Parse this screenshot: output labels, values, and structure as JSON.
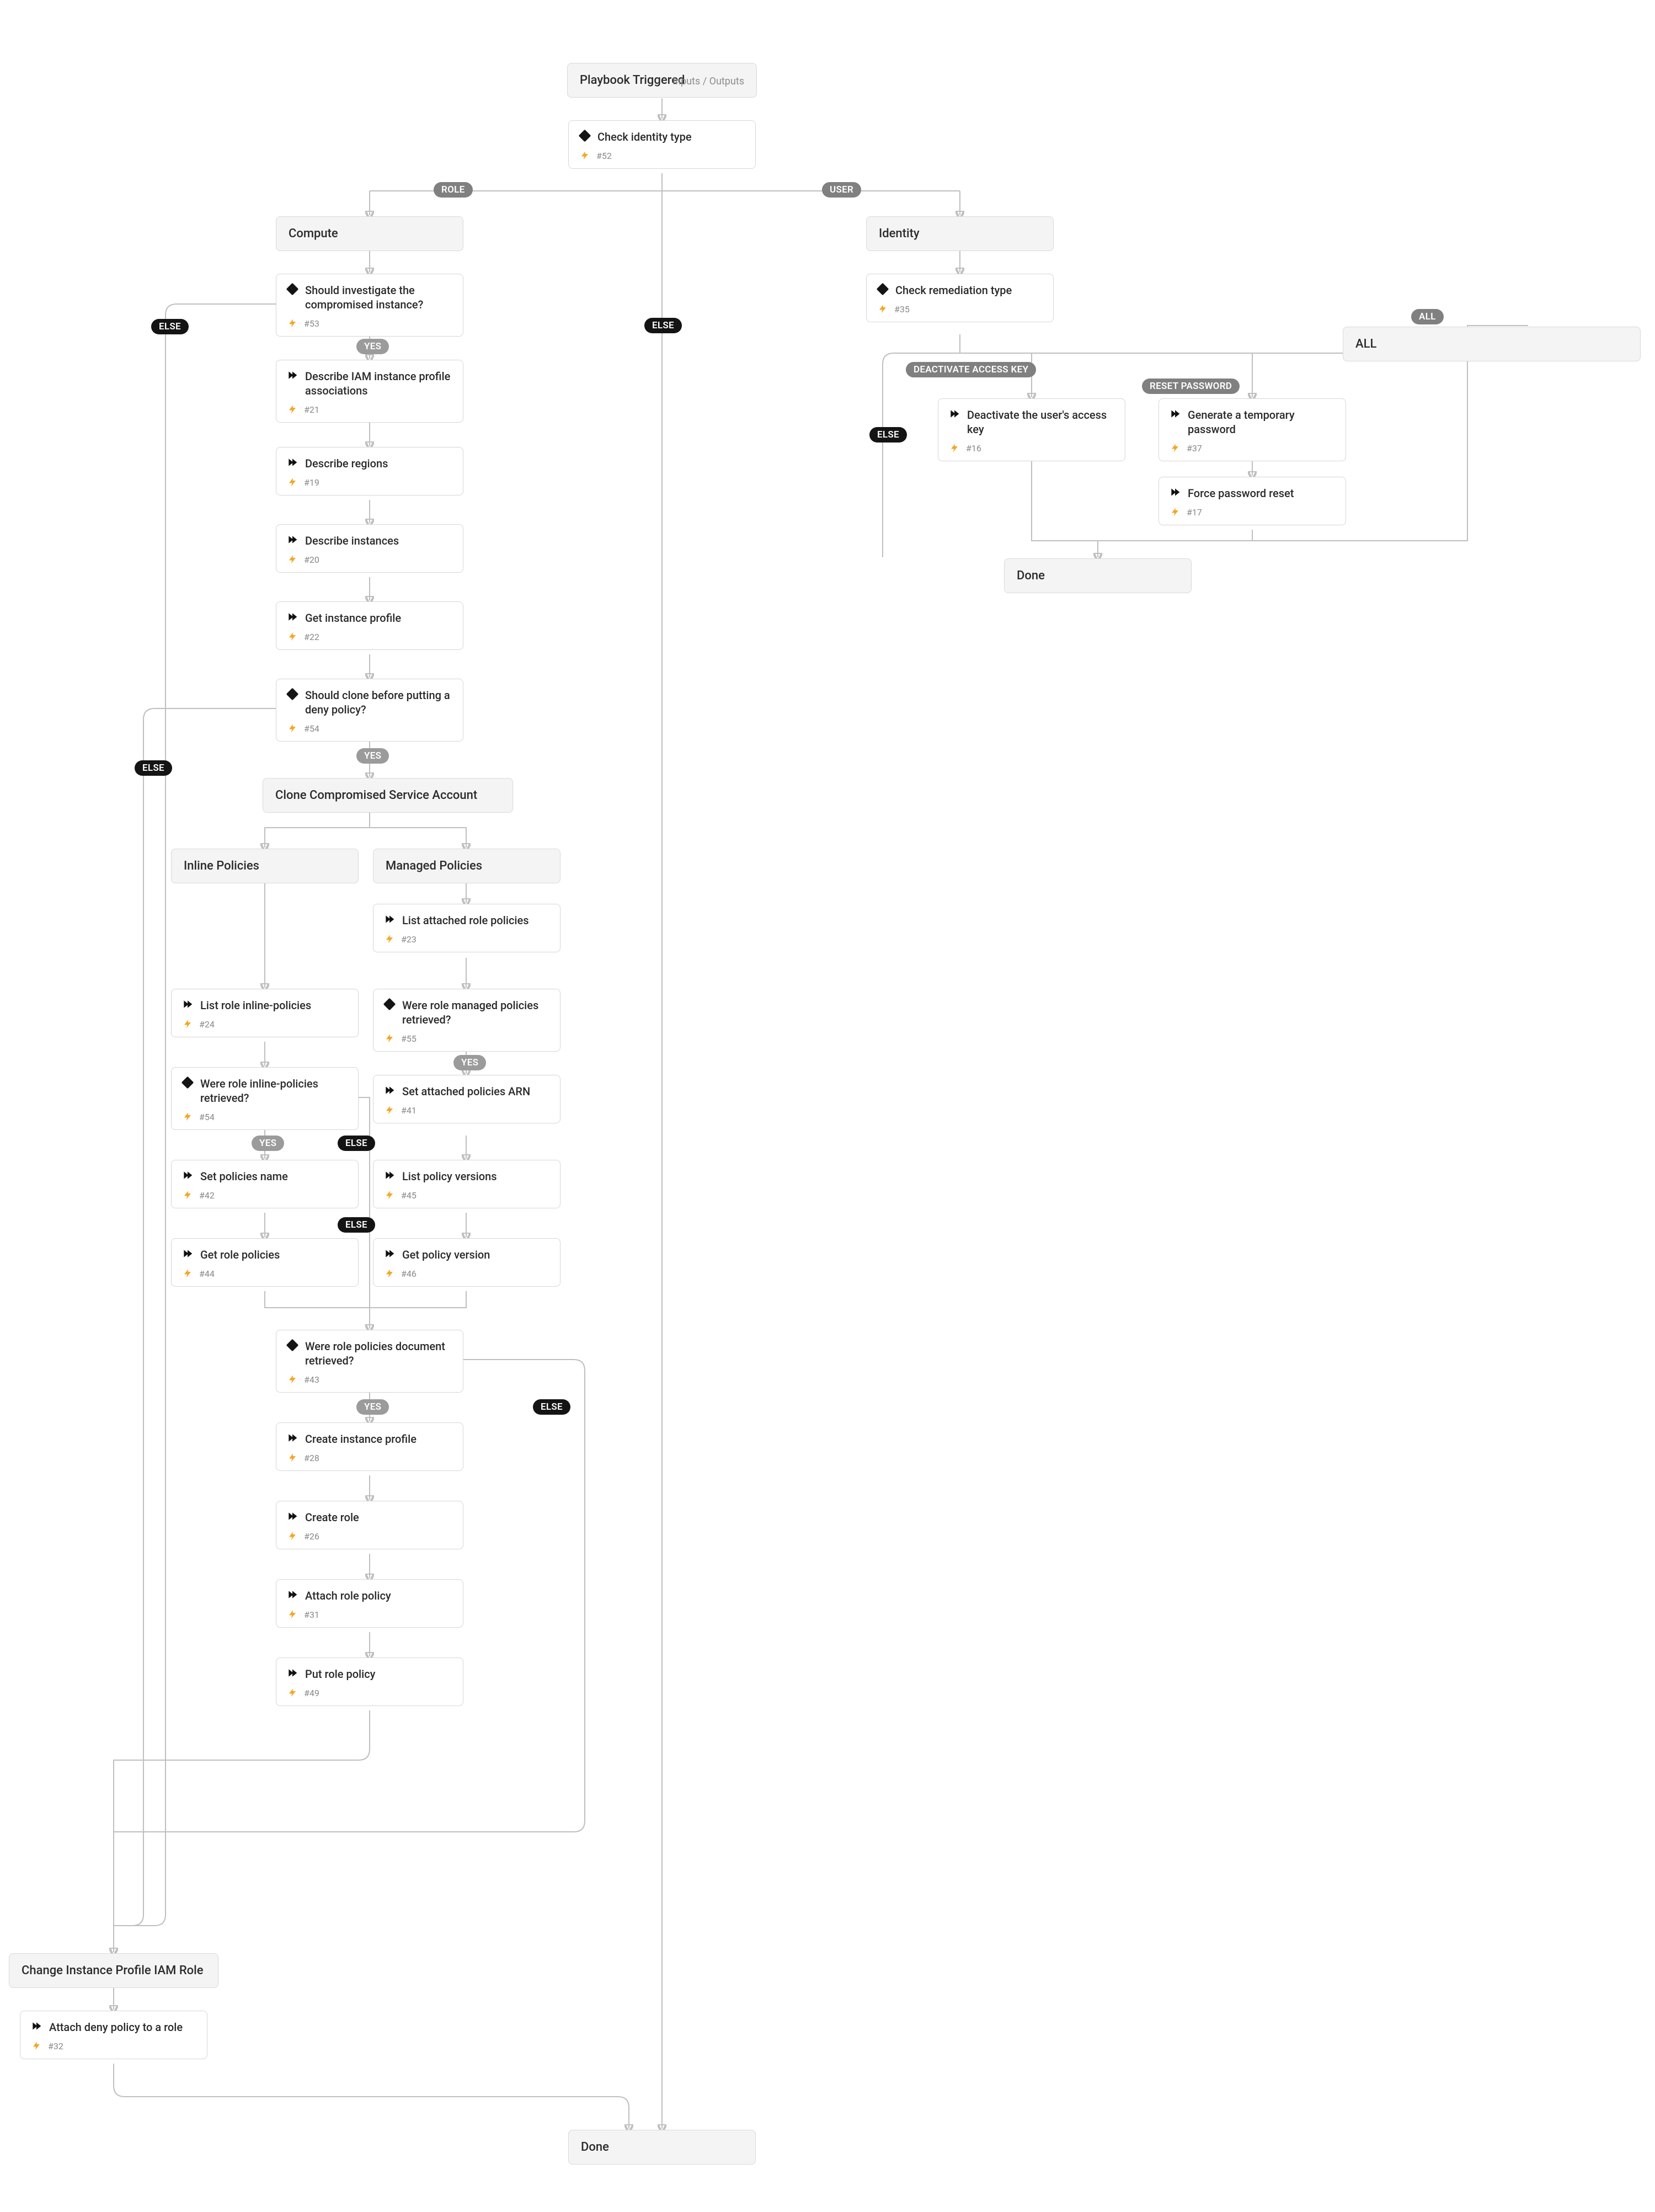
{
  "start": {
    "title": "Playbook Triggered",
    "io": "Inputs / Outputs"
  },
  "sections": {
    "compute": "Compute",
    "identity": "Identity",
    "clone": "Clone Compromised Service Account",
    "inline": "Inline Policies",
    "managed": "Managed Policies",
    "change_profile": "Change Instance Profile IAM Role",
    "all_section": "ALL",
    "done_identity": "Done",
    "done_final": "Done"
  },
  "branches": {
    "role": "ROLE",
    "user": "USER",
    "deactivate": "DEACTIVATE ACCESS KEY",
    "reset": "RESET PASSWORD",
    "all": "ALL"
  },
  "badges": {
    "yes": "YES",
    "else": "ELSE"
  },
  "tasks": {
    "check_identity": {
      "title": "Check identity type",
      "id": "#52",
      "type": "cond"
    },
    "should_investigate": {
      "title": "Should investigate the compromised instance?",
      "id": "#53",
      "type": "cond"
    },
    "describe_assoc": {
      "title": "Describe IAM instance profile associations",
      "id": "#21",
      "type": "action"
    },
    "describe_regions": {
      "title": "Describe regions",
      "id": "#19",
      "type": "action"
    },
    "describe_instances": {
      "title": "Describe instances",
      "id": "#20",
      "type": "action"
    },
    "get_instance_profile": {
      "title": "Get instance profile",
      "id": "#22",
      "type": "action"
    },
    "should_clone": {
      "title": "Should clone before putting a deny policy?",
      "id": "#54",
      "type": "cond"
    },
    "list_inline": {
      "title": "List role inline-policies",
      "id": "#24",
      "type": "action"
    },
    "were_inline": {
      "title": "Were role inline-policies retrieved?",
      "id": "#54",
      "type": "cond"
    },
    "set_policies_name": {
      "title": "Set policies name",
      "id": "#42",
      "type": "action"
    },
    "get_role_policies": {
      "title": "Get role policies",
      "id": "#44",
      "type": "action"
    },
    "list_attached": {
      "title": "List attached role policies",
      "id": "#23",
      "type": "action"
    },
    "were_managed": {
      "title": "Were role managed policies retrieved?",
      "id": "#55",
      "type": "cond"
    },
    "set_attached_arn": {
      "title": "Set attached policies ARN",
      "id": "#41",
      "type": "action"
    },
    "list_policy_versions": {
      "title": "List policy versions",
      "id": "#45",
      "type": "action"
    },
    "get_policy_version": {
      "title": "Get policy version",
      "id": "#46",
      "type": "action"
    },
    "were_docs": {
      "title": "Were role policies document retrieved?",
      "id": "#43",
      "type": "cond"
    },
    "create_instance_prof": {
      "title": "Create instance profile",
      "id": "#28",
      "type": "action"
    },
    "create_role": {
      "title": "Create role",
      "id": "#26",
      "type": "action"
    },
    "attach_role_policy": {
      "title": "Attach role policy",
      "id": "#31",
      "type": "action"
    },
    "put_role_policy": {
      "title": "Put role policy",
      "id": "#49",
      "type": "action"
    },
    "attach_deny": {
      "title": "Attach deny policy to a role",
      "id": "#32",
      "type": "action"
    },
    "check_remediation": {
      "title": "Check remediation type",
      "id": "#35",
      "type": "cond"
    },
    "deactivate_key": {
      "title": "Deactivate the user's access key",
      "id": "#16",
      "type": "action"
    },
    "gen_password": {
      "title": "Generate a temporary password",
      "id": "#37",
      "type": "action"
    },
    "force_reset": {
      "title": "Force password reset",
      "id": "#17",
      "type": "action"
    }
  }
}
